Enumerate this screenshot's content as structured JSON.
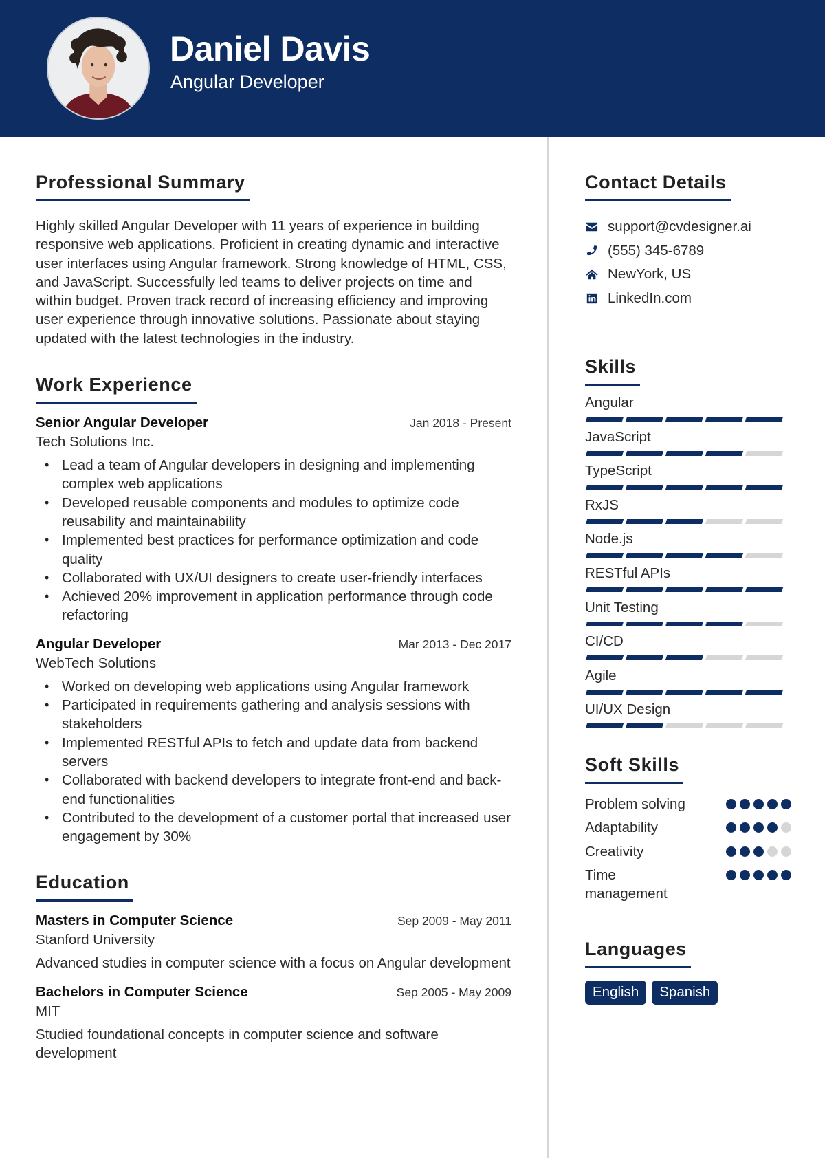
{
  "header": {
    "name": "Daniel Davis",
    "title": "Angular Developer",
    "photo_alt": "profile-photo"
  },
  "colors": {
    "accent": "#0e2d62",
    "inactive": "#d6d6d6",
    "divider": "#d6d6d6"
  },
  "summary": {
    "heading": "Professional Summary",
    "text": "Highly skilled Angular Developer with 11 years of experience in building responsive web applications. Proficient in creating dynamic and interactive user interfaces using Angular framework. Strong knowledge of HTML, CSS, and JavaScript. Successfully led teams to deliver projects on time and within budget. Proven track record of increasing efficiency and improving user experience through innovative solutions. Passionate about staying updated with the latest technologies in the industry."
  },
  "experience": {
    "heading": "Work Experience",
    "jobs": [
      {
        "title": "Senior Angular Developer",
        "dates": "Jan 2018 - Present",
        "company": "Tech Solutions Inc.",
        "bullets": [
          "Lead a team of Angular developers in designing and implementing complex web applications",
          "Developed reusable components and modules to optimize code reusability and maintainability",
          "Implemented best practices for performance optimization and code quality",
          "Collaborated with UX/UI designers to create user-friendly interfaces",
          "Achieved 20% improvement in application performance through code refactoring"
        ]
      },
      {
        "title": "Angular Developer",
        "dates": "Mar 2013 - Dec 2017",
        "company": "WebTech Solutions",
        "bullets": [
          "Worked on developing web applications using Angular framework",
          "Participated in requirements gathering and analysis sessions with stakeholders",
          "Implemented RESTful APIs to fetch and update data from backend servers",
          "Collaborated with backend developers to integrate front-end and back-end functionalities",
          "Contributed to the development of a customer portal that increased user engagement by 30%"
        ]
      }
    ]
  },
  "education": {
    "heading": "Education",
    "items": [
      {
        "degree": "Masters in Computer Science",
        "dates": "Sep 2009 - May 2011",
        "school": "Stanford University",
        "description": "Advanced studies in computer science with a focus on Angular development"
      },
      {
        "degree": "Bachelors in Computer Science",
        "dates": "Sep 2005 - May 2009",
        "school": "MIT",
        "description": "Studied foundational concepts in computer science and software development"
      }
    ]
  },
  "contact": {
    "heading": "Contact Details",
    "items": [
      {
        "icon": "envelope-icon",
        "text": "support@cvdesigner.ai"
      },
      {
        "icon": "phone-icon",
        "text": "(555) 345-6789"
      },
      {
        "icon": "home-icon",
        "text": "NewYork, US"
      },
      {
        "icon": "linkedin-icon",
        "text": "LinkedIn.com"
      }
    ]
  },
  "skills": {
    "heading": "Skills",
    "max": 5,
    "items": [
      {
        "name": "Angular",
        "level": 5
      },
      {
        "name": "JavaScript",
        "level": 4
      },
      {
        "name": "TypeScript",
        "level": 5
      },
      {
        "name": "RxJS",
        "level": 3
      },
      {
        "name": "Node.js",
        "level": 4
      },
      {
        "name": "RESTful APIs",
        "level": 5
      },
      {
        "name": "Unit Testing",
        "level": 4
      },
      {
        "name": "CI/CD",
        "level": 3
      },
      {
        "name": "Agile",
        "level": 5
      },
      {
        "name": "UI/UX Design",
        "level": 2
      }
    ]
  },
  "soft_skills": {
    "heading": "Soft Skills",
    "max": 5,
    "items": [
      {
        "name": "Problem solving",
        "level": 5
      },
      {
        "name": "Adaptability",
        "level": 4
      },
      {
        "name": "Creativity",
        "level": 3
      },
      {
        "name": "Time management",
        "level": 5
      }
    ]
  },
  "languages": {
    "heading": "Languages",
    "items": [
      "English",
      "Spanish"
    ]
  }
}
